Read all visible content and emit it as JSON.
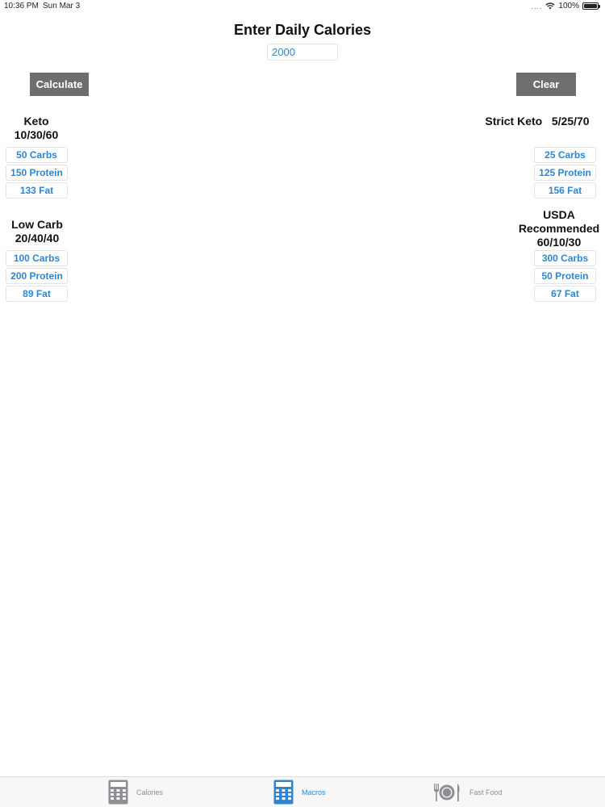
{
  "status": {
    "time": "10:36 PM",
    "date": "Sun Mar 3",
    "signal": "....",
    "battery": "100%"
  },
  "header": {
    "title": "Enter Daily Calories"
  },
  "input": {
    "calories_value": "2000"
  },
  "buttons": {
    "calculate": "Calculate",
    "clear": "Clear"
  },
  "plans": {
    "keto": {
      "name": "Keto",
      "ratio": "10/30/60",
      "carbs": "50 Carbs",
      "protein": "150 Protein",
      "fat": "133 Fat"
    },
    "strict_keto": {
      "name": "Strict Keto   5/25/70",
      "carbs": "25 Carbs",
      "protein": "125 Protein",
      "fat": "156 Fat"
    },
    "low_carb": {
      "name": "Low Carb",
      "ratio": "20/40/40",
      "carbs": "100 Carbs",
      "protein": "200 Protein",
      "fat": "89 Fat"
    },
    "usda": {
      "name": "USDA",
      "name2": "Recommended",
      "ratio": "60/10/30",
      "carbs": "300 Carbs",
      "protein": "50 Protein",
      "fat": "67 Fat"
    }
  },
  "tabs": [
    {
      "label": "Calories",
      "icon": "calculator-icon",
      "active": false
    },
    {
      "label": "Macros",
      "icon": "calculator-icon",
      "active": true
    },
    {
      "label": "Fast Food",
      "icon": "fork-plate-knife-icon",
      "active": false
    }
  ],
  "colors": {
    "accent": "#2f86cf",
    "button": "#6e6d70",
    "inactive_tab": "#8e8e93"
  }
}
